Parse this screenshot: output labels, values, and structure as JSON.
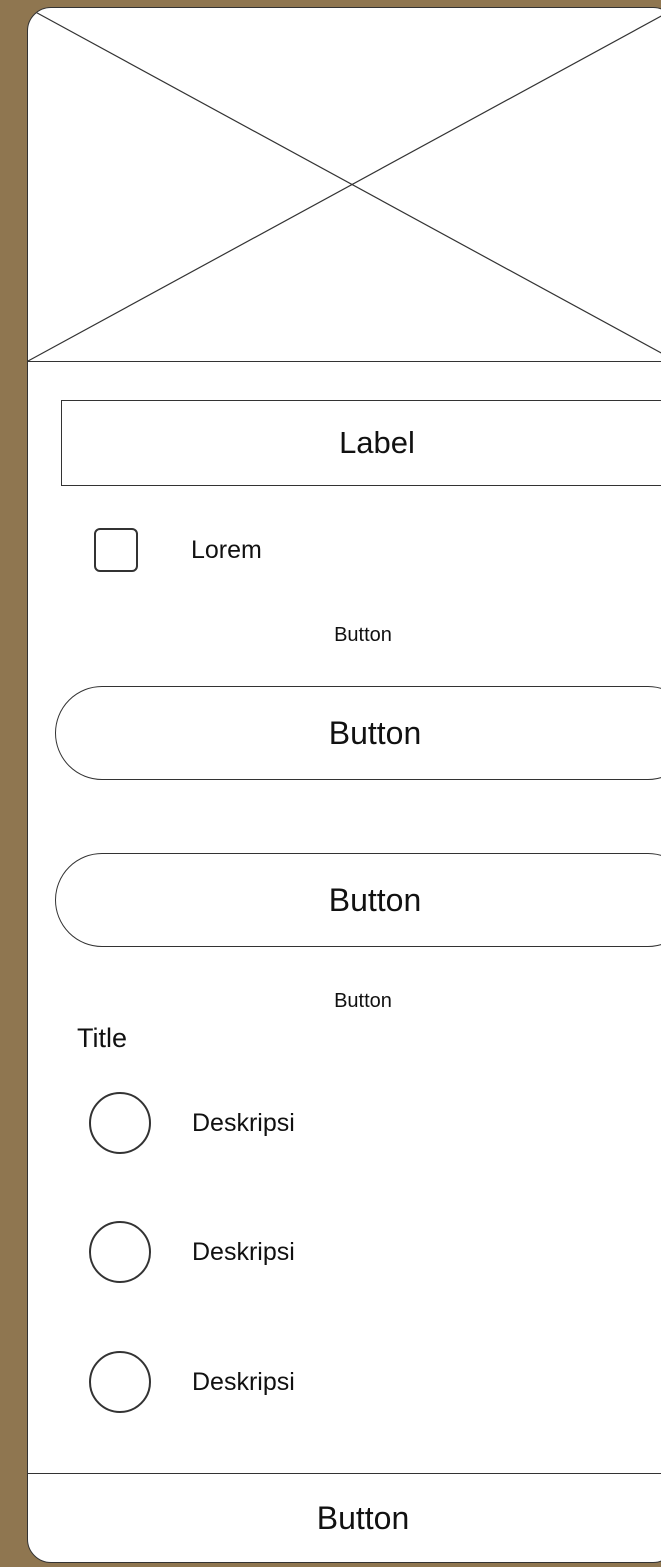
{
  "form": {
    "label_box": "Label",
    "checkbox_label": "Lorem",
    "top_text_button": "Button",
    "primary_button": "Button",
    "secondary_button": "Button",
    "bottom_text_button": "Button"
  },
  "options": {
    "title": "Title",
    "items": [
      {
        "label": "Deskripsi"
      },
      {
        "label": "Deskripsi"
      },
      {
        "label": "Deskripsi"
      }
    ]
  },
  "footer": {
    "button": "Button"
  },
  "colors": {
    "background": "#8f7650",
    "surface": "#ffffff",
    "stroke": "#333333",
    "text": "#111111"
  },
  "icons": {
    "hero": "image-placeholder-icon",
    "checkbox": "checkbox-icon",
    "radio": "radio-button-icon"
  }
}
